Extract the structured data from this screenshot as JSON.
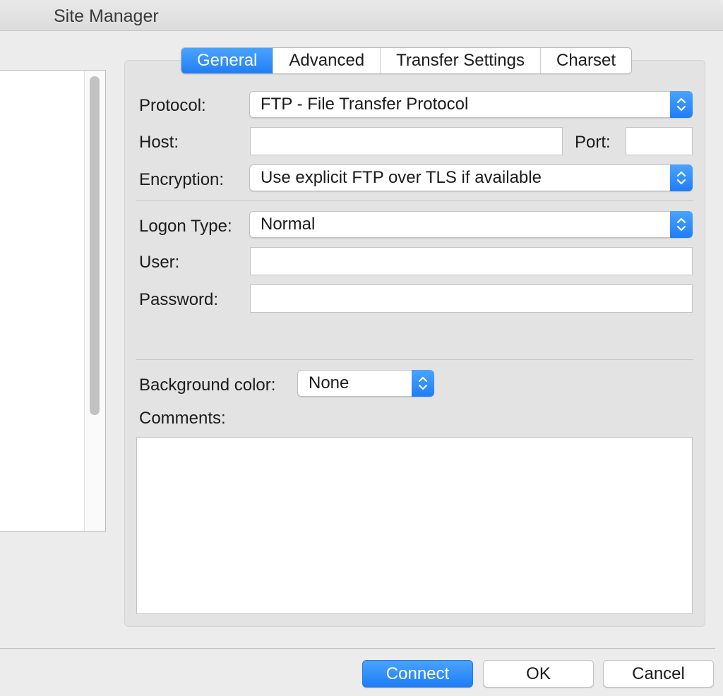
{
  "window": {
    "title": "Site Manager"
  },
  "tabs": [
    {
      "label": "General",
      "active": true
    },
    {
      "label": "Advanced",
      "active": false
    },
    {
      "label": "Transfer Settings",
      "active": false
    },
    {
      "label": "Charset",
      "active": false
    }
  ],
  "general": {
    "protocol_label": "Protocol:",
    "protocol_value": "FTP - File Transfer Protocol",
    "host_label": "Host:",
    "host_value": "",
    "port_label": "Port:",
    "port_value": "",
    "encryption_label": "Encryption:",
    "encryption_value": "Use explicit FTP over TLS if available",
    "logon_type_label": "Logon Type:",
    "logon_type_value": "Normal",
    "user_label": "User:",
    "user_value": "",
    "password_label": "Password:",
    "password_value": "",
    "background_color_label": "Background color:",
    "background_color_value": "None",
    "comments_label": "Comments:",
    "comments_value": ""
  },
  "buttons": {
    "connect": "Connect",
    "ok": "OK",
    "cancel": "Cancel"
  },
  "colors": {
    "accent": "#1f7ef6",
    "window_bg": "#ececec",
    "panel_bg": "#e3e3e3"
  },
  "icons": {
    "select_arrows": "chevron-up-down-icon"
  }
}
